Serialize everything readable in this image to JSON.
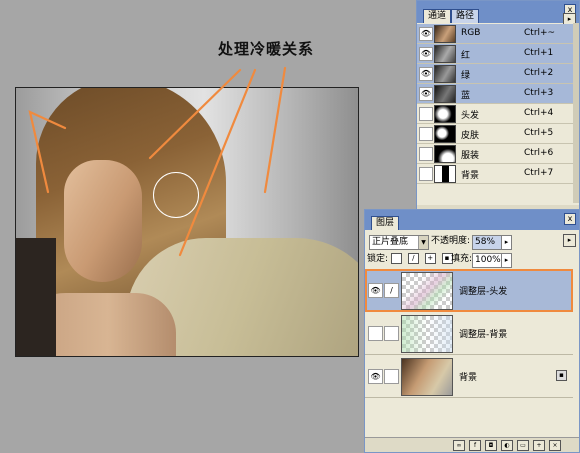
{
  "annotation": {
    "title": "处理冷暖关系"
  },
  "channels_panel": {
    "tabs": [
      {
        "label": "通道"
      },
      {
        "label": "路径"
      }
    ],
    "close_label": "x",
    "menu_label": "▸",
    "rows": [
      {
        "name": "RGB",
        "shortcut": "Ctrl+~",
        "selected": true,
        "visible": true
      },
      {
        "name": "红",
        "shortcut": "Ctrl+1",
        "selected": true,
        "visible": true
      },
      {
        "name": "绿",
        "shortcut": "Ctrl+2",
        "selected": true,
        "visible": true
      },
      {
        "name": "蓝",
        "shortcut": "Ctrl+3",
        "selected": true,
        "visible": true
      },
      {
        "name": "头发",
        "shortcut": "Ctrl+4",
        "selected": false,
        "visible": false
      },
      {
        "name": "皮肤",
        "shortcut": "Ctrl+5",
        "selected": false,
        "visible": false
      },
      {
        "name": "服装",
        "shortcut": "Ctrl+6",
        "selected": false,
        "visible": false
      },
      {
        "name": "背景",
        "shortcut": "Ctrl+7",
        "selected": false,
        "visible": false
      }
    ]
  },
  "layers_panel": {
    "tab_label": "图层",
    "close_label": "x",
    "menu_label": "▸",
    "blend_mode": "正片叠底",
    "opacity_label": "不透明度:",
    "opacity_value": "58%",
    "lock_label": "锁定:",
    "fill_label": "填充:",
    "fill_value": "100%",
    "layers": [
      {
        "name": "调整层-头发",
        "selected": true,
        "visible": true
      },
      {
        "name": "调整层-背景",
        "selected": false,
        "visible": false
      },
      {
        "name": "背景",
        "selected": false,
        "visible": true,
        "locked": true
      }
    ]
  },
  "icons": {
    "eye": "eye-icon",
    "brush": "brush-icon",
    "lock": "lock-icon",
    "arrow": "stepper-arrow-icon"
  },
  "colors": {
    "accent_orange": "#f08a3e",
    "selection_blue": "#a6b8d8"
  }
}
